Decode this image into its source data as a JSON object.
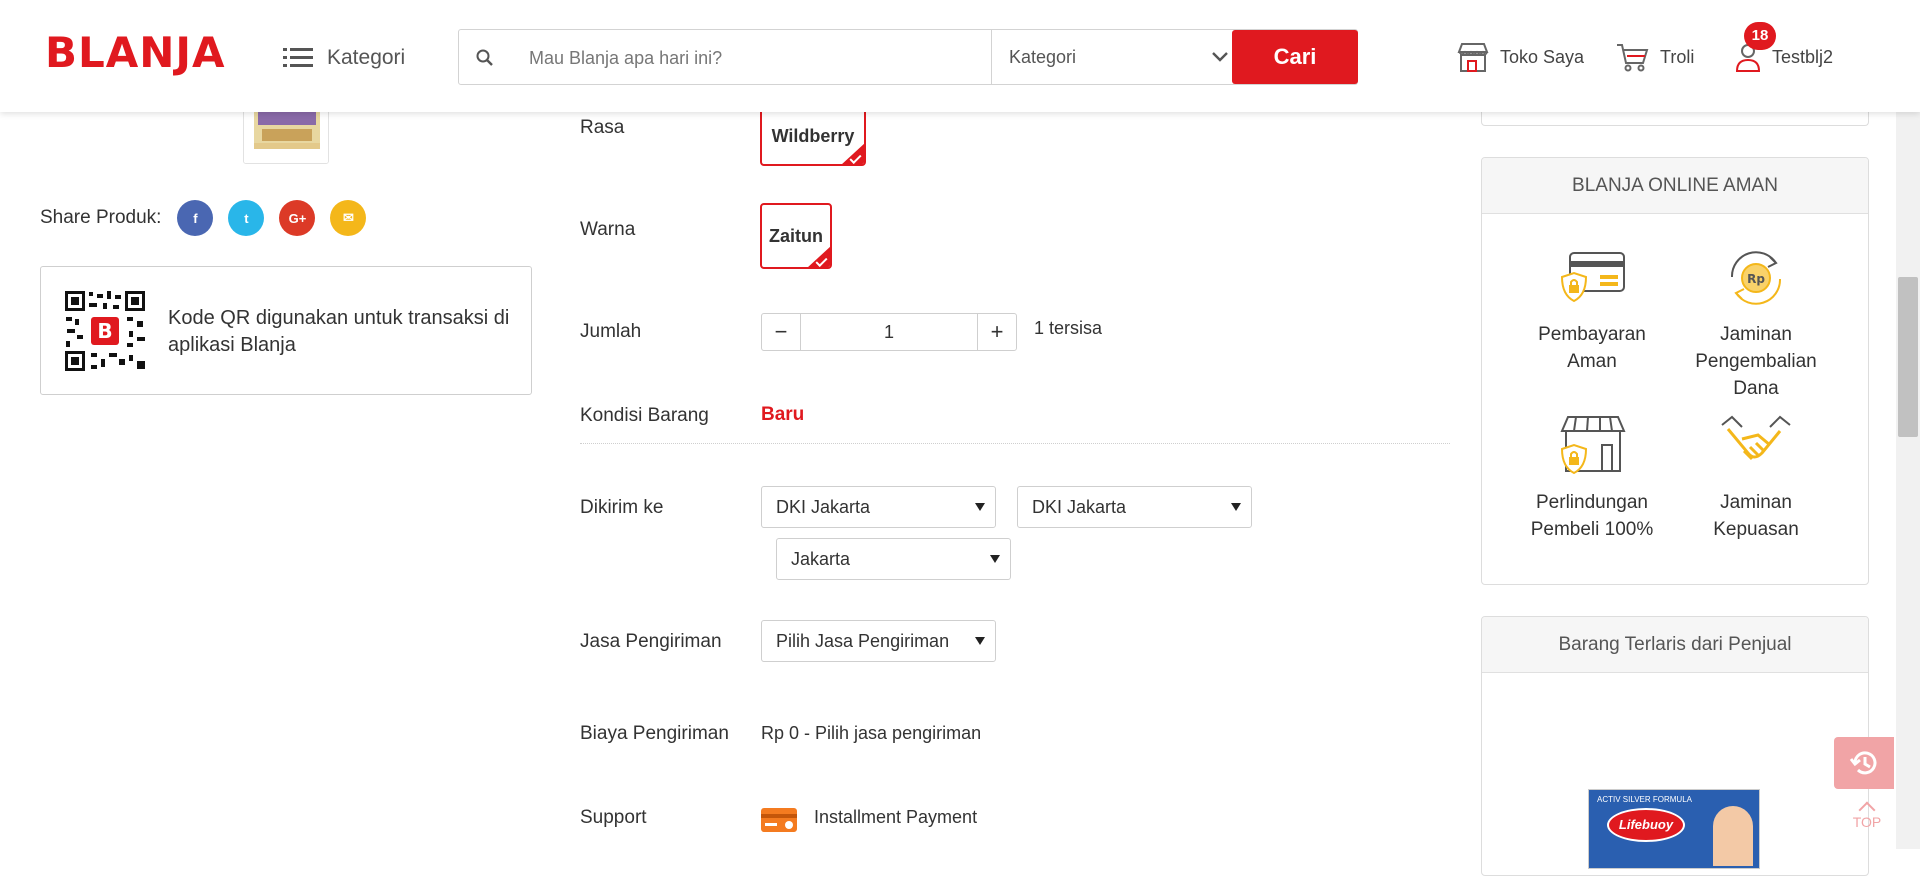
{
  "header": {
    "logo": "BLANJA",
    "kategori_label": "Kategori",
    "search_placeholder": "Mau Blanja apa hari ini?",
    "search_category": "Kategori",
    "search_button": "Cari",
    "toko_saya": "Toko Saya",
    "troli": "Troli",
    "user_name": "Testblj2",
    "badge_count": "18"
  },
  "left": {
    "share_label": "Share Produk:",
    "social": [
      {
        "name": "facebook",
        "glyph": "f",
        "color": "#4a67b2"
      },
      {
        "name": "twitter",
        "glyph": "t",
        "color": "#29b6e9"
      },
      {
        "name": "google-plus",
        "glyph": "G+",
        "color": "#dc3a27"
      },
      {
        "name": "email",
        "glyph": "✉",
        "color": "#f4b71a"
      }
    ],
    "qr_text": "Kode QR digunakan untuk transaksi di aplikasi Blanja"
  },
  "form": {
    "rasa_label": "Rasa",
    "rasa_value": "Wildberry",
    "warna_label": "Warna",
    "warna_value": "Zaitun",
    "jumlah_label": "Jumlah",
    "qty_minus": "−",
    "qty_value": "1",
    "qty_plus": "+",
    "stock_text": "1 tersisa",
    "kondisi_label": "Kondisi Barang",
    "kondisi_value": "Baru",
    "dikirim_label": "Dikirim ke",
    "province": "DKI Jakarta",
    "city": "DKI Jakarta",
    "district": "Jakarta",
    "jasa_label": "Jasa Pengiriman",
    "jasa_value": "Pilih Jasa Pengiriman",
    "biaya_label": "Biaya Pengiriman",
    "biaya_value": "Rp 0 - Pilih jasa pengiriman",
    "support_label": "Support",
    "support_value": "Installment Payment"
  },
  "right": {
    "aman_title": "BLANJA ONLINE AMAN",
    "features": [
      {
        "label": "Pembayaran Aman",
        "icon": "card-shield-icon"
      },
      {
        "label": "Jaminan Pengembalian Dana",
        "icon": "money-back-icon"
      },
      {
        "label": "Perlindungan Pembeli 100%",
        "icon": "store-shield-icon"
      },
      {
        "label": "Jaminan Kepuasan",
        "icon": "handshake-icon"
      }
    ],
    "terlaris_title": "Barang Terlaris dari Penjual",
    "product_brand": "Lifebuoy",
    "product_tagline": "ACTIV SILVER FORMULA"
  },
  "floating": {
    "top_label": "TOP"
  },
  "colors": {
    "brand_red": "#e0191f",
    "feature_gold": "#f4b71a",
    "floating_pink": "#f1a4a6"
  }
}
